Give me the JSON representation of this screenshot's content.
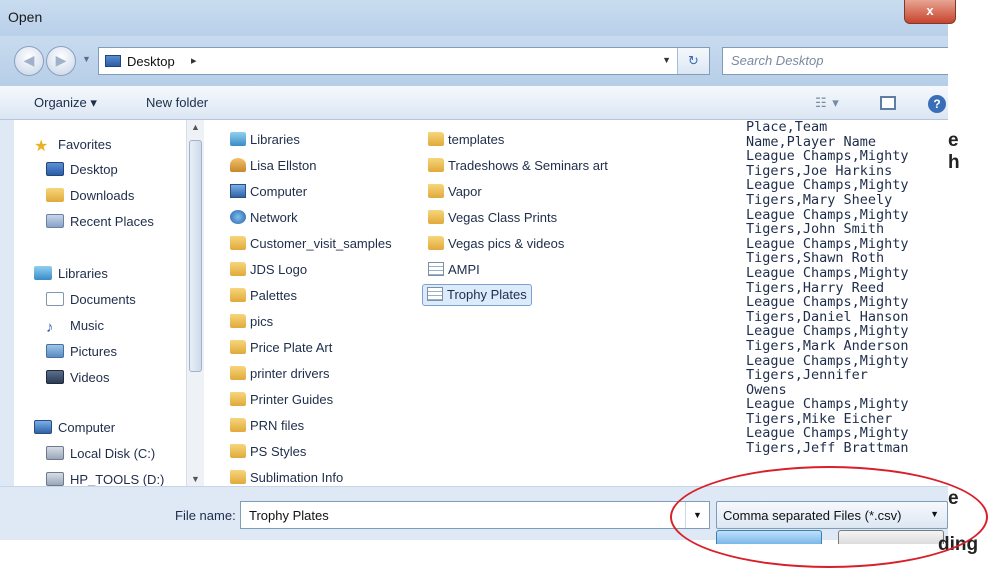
{
  "background_fragments": [
    "e",
    "h",
    "e",
    "ding"
  ],
  "dialog": {
    "title": "Open",
    "close_glyph": "x"
  },
  "nav": {
    "back_glyph": "◀",
    "forward_glyph": "▶",
    "address_crumb": "Desktop",
    "crumb_arrow": "▸",
    "refresh_glyph": "↻",
    "search_placeholder": "Search Desktop"
  },
  "toolbar": {
    "organize_label": "Organize ▾",
    "new_folder_label": "New folder",
    "view_glyph": "☷ ▾",
    "help_glyph": "?"
  },
  "navigation_pane": {
    "items": [
      {
        "label": "Favorites",
        "icon": "star-icon",
        "level": "group"
      },
      {
        "label": "Desktop",
        "icon": "desktop-icon",
        "level": "sub"
      },
      {
        "label": "Downloads",
        "icon": "downloads-icon",
        "level": "sub"
      },
      {
        "label": "Recent Places",
        "icon": "recent-places-icon",
        "level": "sub"
      },
      {
        "label": "Libraries",
        "icon": "libraries-icon",
        "level": "group"
      },
      {
        "label": "Documents",
        "icon": "documents-icon",
        "level": "sub"
      },
      {
        "label": "Music",
        "icon": "music-icon",
        "level": "sub"
      },
      {
        "label": "Pictures",
        "icon": "pictures-icon",
        "level": "sub"
      },
      {
        "label": "Videos",
        "icon": "videos-icon",
        "level": "sub"
      },
      {
        "label": "Computer",
        "icon": "computer-icon",
        "level": "group"
      },
      {
        "label": "Local Disk (C:)",
        "icon": "drive-icon",
        "level": "sub"
      },
      {
        "label": "HP_TOOLS (D:)",
        "icon": "drive-icon",
        "level": "sub"
      }
    ]
  },
  "files": {
    "column1": [
      {
        "label": "Libraries",
        "icon": "libraries-icon"
      },
      {
        "label": "Lisa Ellston",
        "icon": "user-folder-icon"
      },
      {
        "label": "Computer",
        "icon": "computer-icon"
      },
      {
        "label": "Network",
        "icon": "network-icon"
      },
      {
        "label": "Customer_visit_samples",
        "icon": "folder-icon"
      },
      {
        "label": "JDS Logo",
        "icon": "folder-icon"
      },
      {
        "label": "Palettes",
        "icon": "folder-icon"
      },
      {
        "label": "pics",
        "icon": "folder-icon"
      },
      {
        "label": "Price Plate Art",
        "icon": "folder-icon"
      },
      {
        "label": "printer drivers",
        "icon": "folder-icon"
      },
      {
        "label": "Printer Guides",
        "icon": "folder-icon"
      },
      {
        "label": "PRN files",
        "icon": "folder-icon"
      },
      {
        "label": "PS Styles",
        "icon": "folder-icon"
      },
      {
        "label": "Sublimation Info",
        "icon": "folder-icon"
      }
    ],
    "column2": [
      {
        "label": "templates",
        "icon": "folder-icon"
      },
      {
        "label": "Tradeshows & Seminars art",
        "icon": "folder-icon"
      },
      {
        "label": "Vapor",
        "icon": "folder-icon"
      },
      {
        "label": "Vegas Class Prints",
        "icon": "folder-icon"
      },
      {
        "label": "Vegas pics & videos",
        "icon": "folder-icon"
      },
      {
        "label": "AMPI",
        "icon": "csv-file-icon"
      },
      {
        "label": "Trophy Plates",
        "icon": "csv-file-icon",
        "selected": true
      }
    ]
  },
  "preview_lines": [
    "Place,Team",
    "Name,Player Name",
    "League Champs,Mighty",
    "Tigers,Joe Harkins",
    "League Champs,Mighty",
    "Tigers,Mary Sheely",
    "League Champs,Mighty",
    "Tigers,John Smith",
    "League Champs,Mighty",
    "Tigers,Shawn Roth",
    "League Champs,Mighty",
    "Tigers,Harry Reed",
    "League Champs,Mighty",
    "Tigers,Daniel Hanson",
    "League Champs,Mighty",
    "Tigers,Mark Anderson",
    "League Champs,Mighty",
    "Tigers,Jennifer",
    "Owens",
    "League Champs,Mighty",
    "Tigers,Mike Eicher",
    "League Champs,Mighty",
    "Tigers,Jeff Brattman"
  ],
  "bottom": {
    "file_name_label": "File name:",
    "file_name_value": "Trophy Plates",
    "dropdown_glyph": "▼",
    "file_type_value": "Comma separated Files (*.csv)"
  },
  "colors": {
    "annotation": "#d8202a",
    "selection": "#dcebfc",
    "window_frame": "#dfe9f5"
  }
}
